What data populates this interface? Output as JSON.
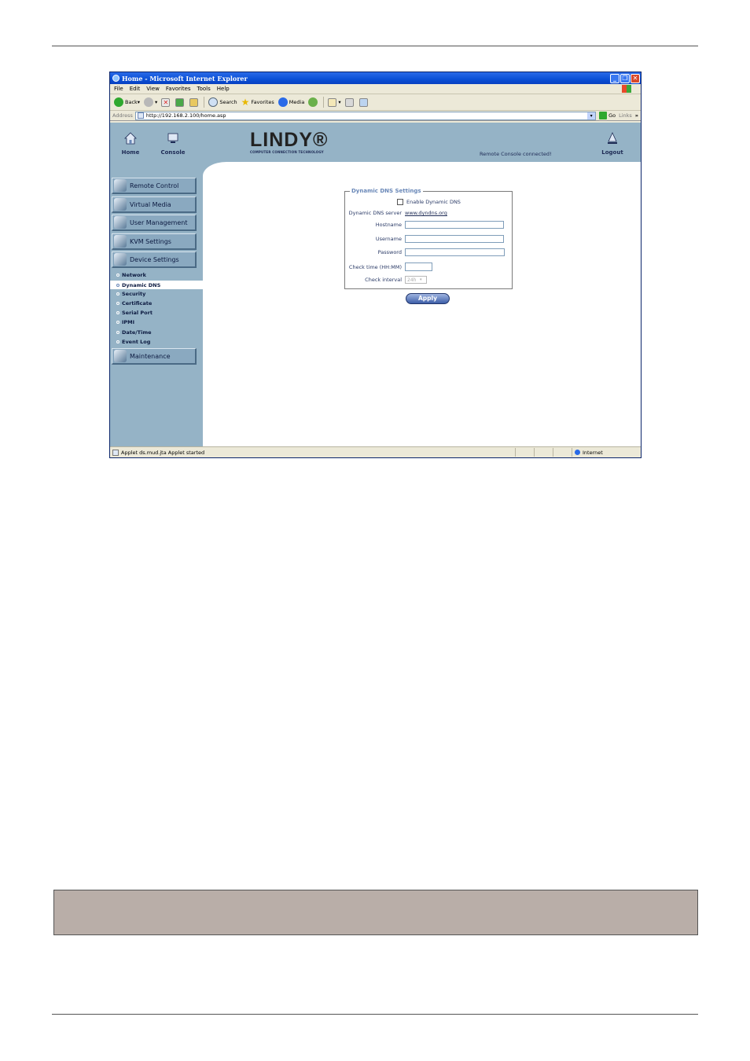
{
  "window": {
    "title": "Home - Microsoft Internet Explorer"
  },
  "menu": [
    "File",
    "Edit",
    "View",
    "Favorites",
    "Tools",
    "Help"
  ],
  "toolbar": {
    "back": "Back",
    "search": "Search",
    "favorites": "Favorites",
    "media": "Media"
  },
  "address": {
    "label": "Address",
    "url": "http://192.168.2.100/home.asp",
    "go": "Go",
    "links": "Links",
    "more": "»"
  },
  "header": {
    "home": "Home",
    "console": "Console",
    "logout": "Logout",
    "logo_text": "LINDY®",
    "logo_tagline": "COMPUTER CONNECTION TECHNOLOGY",
    "status": "Remote Console connected!"
  },
  "sidebar": {
    "main": [
      "Remote Control",
      "Virtual Media",
      "User Management",
      "KVM Settings",
      "Device Settings"
    ],
    "sub": [
      "Network",
      "Dynamic DNS",
      "Security",
      "Certificate",
      "Serial Port",
      "IPMI",
      "Date/Time",
      "Event Log"
    ],
    "maintenance": "Maintenance"
  },
  "form": {
    "legend": "Dynamic DNS Settings",
    "enable_label": "Enable Dynamic DNS",
    "server_label": "Dynamic DNS server",
    "server_value": "www.dyndns.org",
    "hostname_label": "Hostname",
    "username_label": "Username",
    "password_label": "Password",
    "check_time_label": "Check time (HH:MM)",
    "check_interval_label": "Check interval",
    "check_interval_value": "24h",
    "apply": "Apply"
  },
  "statusbar": {
    "text": "Applet ds.mud.jta Applet started",
    "zone": "Internet"
  },
  "colors": {
    "panel": "#95b3c6",
    "titlebar": "#0a4fd6",
    "accent": "#6a88b8"
  }
}
